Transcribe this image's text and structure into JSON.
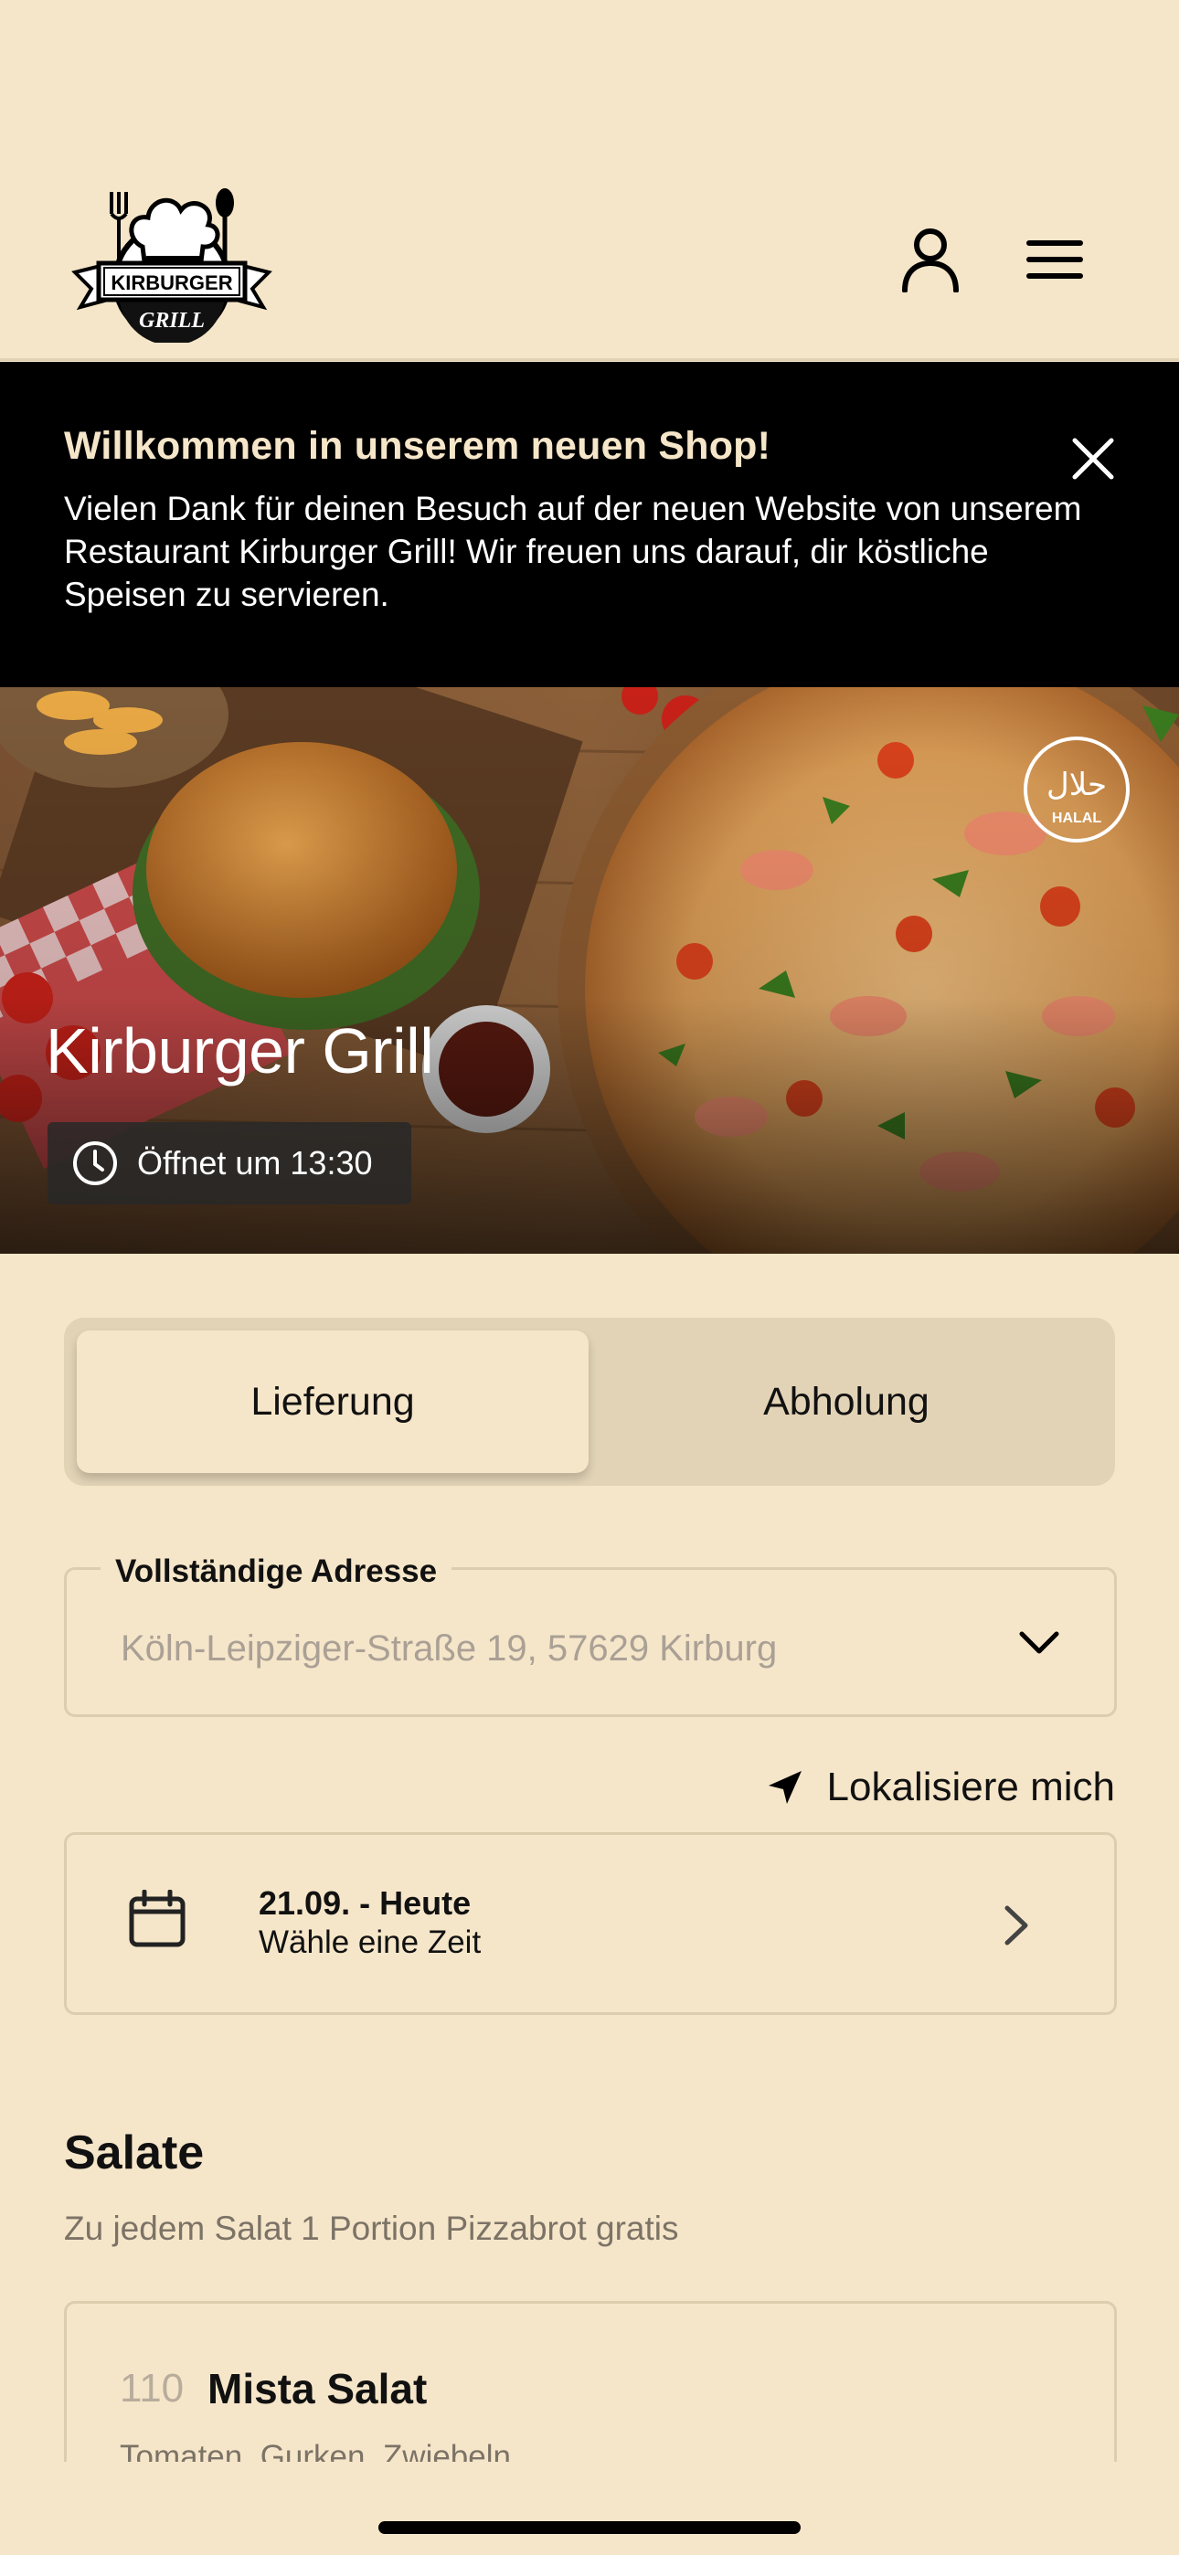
{
  "header": {
    "logo_text_top": "KIRBURGER",
    "logo_text_bottom": "GRILL",
    "icons": [
      "user-icon",
      "menu-icon"
    ]
  },
  "banner": {
    "title": "Willkommen in unserem neuen Shop!",
    "text": "Vielen Dank für deinen Besuch auf der neuen Website von unserem Restaurant Kirburger Grill! Wir freuen uns darauf, dir köstliche Speisen zu servieren."
  },
  "hero": {
    "restaurant_name": "Kirburger Grill",
    "hours": "Öffnet um 13:30",
    "halal_label": "HALAL",
    "halal_script": "حلال"
  },
  "order_type": {
    "delivery": "Lieferung",
    "pickup": "Abholung",
    "selected": "Lieferung"
  },
  "address": {
    "label": "Vollständige Adresse",
    "placeholder": "Köln-Leipziger-Straße 19, 57629 Kirburg"
  },
  "locate": {
    "label": "Lokalisiere mich"
  },
  "date": {
    "title": "21.09. - Heute",
    "subtitle": "Wähle eine Zeit"
  },
  "section": {
    "title": "Salate",
    "subtitle": "Zu jedem Salat 1 Portion Pizzabrot gratis",
    "items": [
      {
        "number": "110",
        "name": "Mista Salat",
        "description": "Tomaten, Gurken, Zwiebeln"
      }
    ]
  },
  "colors": {
    "background": "#f6e6c9",
    "banner_bg": "#000000",
    "banner_title": "#f6e6c9",
    "toggle_bg": "#e2d3b6",
    "muted_text": "#7c7367"
  }
}
